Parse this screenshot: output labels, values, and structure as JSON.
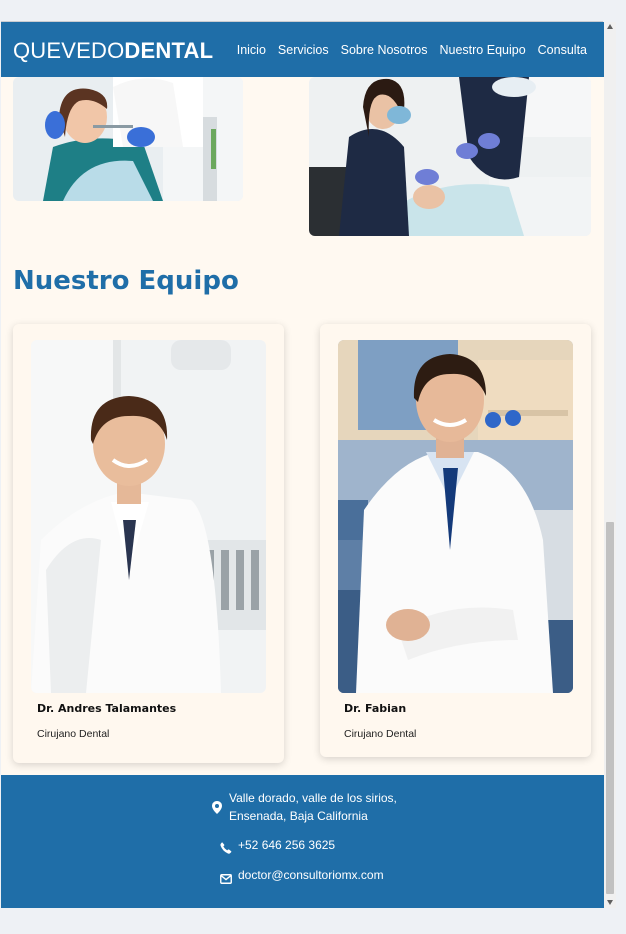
{
  "brand": {
    "light": "QUEVEDO",
    "bold": "DENTAL"
  },
  "nav": {
    "items": [
      "Inicio",
      "Servicios",
      "Sobre Nosotros",
      "Nuestro Equipo",
      "Consulta"
    ]
  },
  "team_section": {
    "title": "Nuestro Equipo",
    "members": [
      {
        "name": "Dr. Andres Talamantes",
        "role": "Cirujano Dental"
      },
      {
        "name": "Dr. Fabian",
        "role": "Cirujano Dental"
      }
    ]
  },
  "footer": {
    "address_line1": "Valle dorado, valle de los sirios,",
    "address_line2": "Ensenada, Baja California",
    "phone": "+52 646 256 3625",
    "email": "doctor@consultoriomx.com"
  },
  "icons": [
    "map-pin-icon",
    "phone-icon",
    "envelope-icon"
  ],
  "colors": {
    "primary": "#1f6ea8",
    "page_background": "#fff9f1"
  }
}
